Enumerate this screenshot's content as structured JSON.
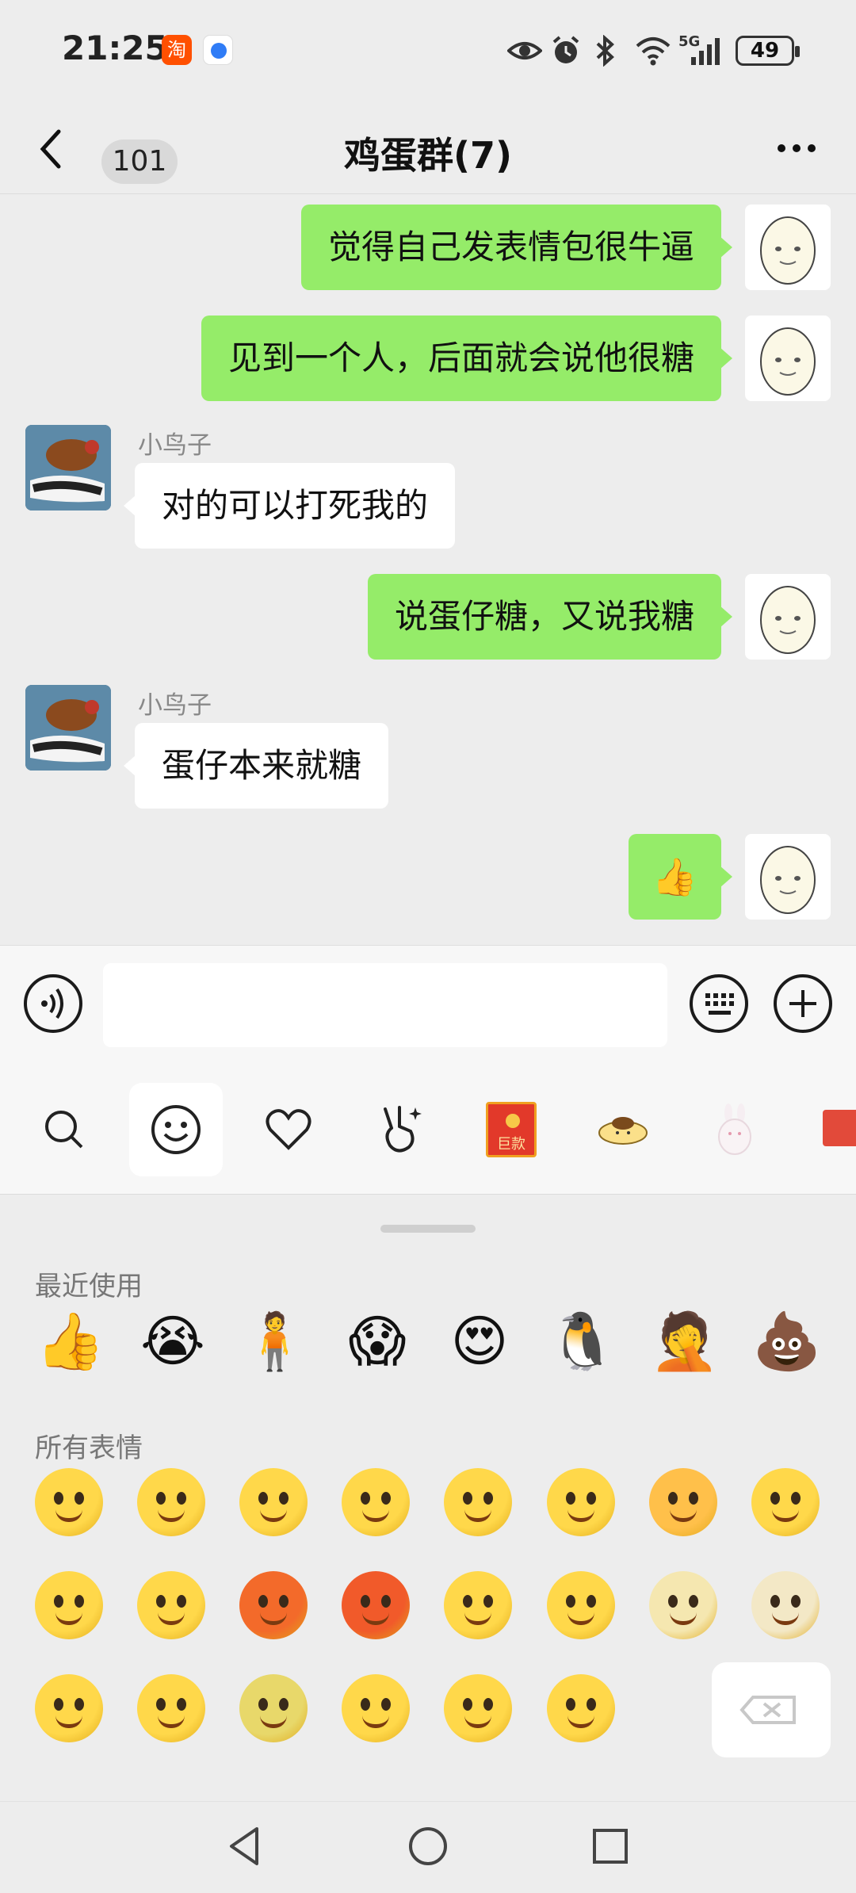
{
  "status_bar": {
    "time": "21:25",
    "app_icon_1": "淘",
    "battery": "49",
    "network": "5G"
  },
  "header": {
    "back_count": "101",
    "title": "鸡蛋群(7)"
  },
  "messages": [
    {
      "side": "out",
      "text": "觉得自己发表情包很牛逼"
    },
    {
      "side": "out",
      "text": "见到一个人，后面就会说他很糖"
    },
    {
      "side": "in",
      "sender": "小鸟子",
      "text": "对的可以打死我的"
    },
    {
      "side": "out",
      "text": "说蛋仔糖，又说我糖"
    },
    {
      "side": "in",
      "sender": "小鸟子",
      "text": "蛋仔本来就糖"
    },
    {
      "side": "out",
      "text": "👍"
    }
  ],
  "emoji_panel": {
    "recent_label": "最近使用",
    "all_label": "所有表情",
    "recent": [
      "👍",
      "😭",
      "🧍",
      "😱",
      "😍",
      "🐧",
      "🤦",
      "💩"
    ],
    "tab_red_packet_label": "巨款"
  },
  "colors": {
    "bubble_out": "#95ec69",
    "bubble_in": "#ffffff",
    "background": "#ededed"
  }
}
